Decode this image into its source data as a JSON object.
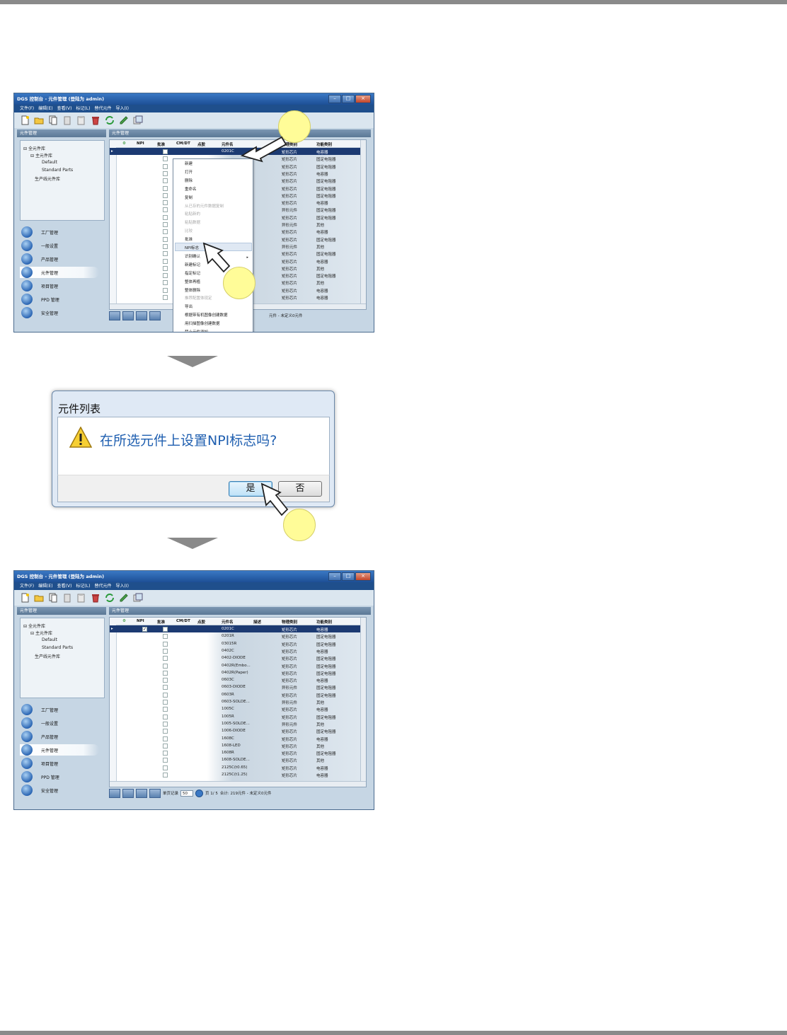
{
  "window": {
    "title": "DGS 控制台 - 元件管理 (登陆为 admin)",
    "menu": [
      "文件(F)",
      "编辑(E)",
      "查看(V)",
      "标记(L)",
      "替代元件",
      "导入(I)"
    ],
    "left_panel_title": "元件管理",
    "right_panel_title": "元件管理",
    "tree": [
      "全元件库",
      "主元件库",
      "Default",
      "Standard Parts",
      "生产线元件库"
    ],
    "nav": [
      "工厂管理",
      "一般设置",
      "产品管理",
      "元件管理",
      "项目管理",
      "PPD 管理",
      "安全管理"
    ],
    "active_nav": "元件管理",
    "columns": [
      "NPI",
      "批准",
      "CM/DT",
      "点胶",
      "元件名",
      "描述",
      "物理类别",
      "功能类别"
    ]
  },
  "screen1": {
    "rows": [
      {
        "name": "0201C",
        "phys": "矩形芯片",
        "func": "电容器"
      },
      {
        "name": "",
        "phys": "矩形芯片",
        "func": "固定电阻器"
      },
      {
        "name": "",
        "phys": "矩形芯片",
        "func": "固定电阻器"
      },
      {
        "name": "",
        "phys": "矩形芯片",
        "func": "电容器"
      },
      {
        "name": "",
        "phys": "矩形芯片",
        "func": "固定电阻器"
      },
      {
        "name": "",
        "phys": "矩形芯片",
        "func": "固定电阻器"
      },
      {
        "name": "",
        "phys": "矩形芯片",
        "func": "固定电阻器"
      },
      {
        "name": "",
        "phys": "矩形芯片",
        "func": "电容器"
      },
      {
        "name": "",
        "phys": "异形元件",
        "func": "固定电阻器"
      },
      {
        "name": "",
        "phys": "矩形芯片",
        "func": "固定电阻器"
      },
      {
        "name": "",
        "phys": "异形元件",
        "func": "其他"
      },
      {
        "name": "",
        "phys": "矩形芯片",
        "func": "电容器"
      },
      {
        "name": "",
        "phys": "矩形芯片",
        "func": "固定电阻器"
      },
      {
        "name": "",
        "phys": "异形元件",
        "func": "其他"
      },
      {
        "name": "",
        "phys": "矩形芯片",
        "func": "固定电阻器"
      },
      {
        "name": "",
        "phys": "矩形芯片",
        "func": "电容器"
      },
      {
        "name": "",
        "phys": "矩形芯片",
        "func": "其他"
      },
      {
        "name": "",
        "phys": "矩形芯片",
        "func": "固定电阻器"
      },
      {
        "name": "",
        "phys": "矩形芯片",
        "func": "其他"
      },
      {
        "name": "",
        "phys": "矩形芯片",
        "func": "电容器"
      },
      {
        "name": "",
        "phys": "矩形芯片",
        "func": "电容器"
      }
    ],
    "status_text": "元件 - 未定义0元件",
    "context_menu": [
      {
        "label": "新建",
        "disabled": false
      },
      {
        "label": "打开",
        "disabled": false
      },
      {
        "label": "删除",
        "disabled": false
      },
      {
        "label": "重命名",
        "disabled": false
      },
      {
        "label": "复制",
        "disabled": false
      },
      {
        "label": "从已存的元件数据复制",
        "disabled": true
      },
      {
        "label": "粘贴新的",
        "disabled": true
      },
      {
        "label": "粘贴数据",
        "disabled": true
      },
      {
        "label": "比较",
        "disabled": true
      },
      {
        "label": "批准",
        "disabled": false
      },
      {
        "label": "NPI标志",
        "disabled": false
      },
      {
        "label": "识别确认",
        "disabled": false
      },
      {
        "label": "新建标记",
        "disabled": false
      },
      {
        "label": "指定标记",
        "disabled": false
      },
      {
        "label": "整体再植",
        "disabled": false
      },
      {
        "label": "整体删除",
        "disabled": false
      },
      {
        "label": "推荐配置体现定",
        "disabled": true
      },
      {
        "label": "导出",
        "disabled": false
      },
      {
        "label": "根据带有机图像创建数据",
        "disabled": false
      },
      {
        "label": "用扫描图像创建数据",
        "disabled": false
      },
      {
        "label": "禁止元件添加",
        "disabled": false
      }
    ]
  },
  "dialog": {
    "title": "元件列表",
    "message": "在所选元件上设置NPI标志吗?",
    "yes": "是",
    "no": "否"
  },
  "screen2": {
    "rows": [
      {
        "name": "0201C",
        "phys": "矩形芯片",
        "func": "电容器",
        "npi": true
      },
      {
        "name": "0201R",
        "phys": "矩形芯片",
        "func": "固定电阻器"
      },
      {
        "name": "03015R",
        "phys": "矩形芯片",
        "func": "固定电阻器"
      },
      {
        "name": "0402C",
        "phys": "矩形芯片",
        "func": "电容器"
      },
      {
        "name": "0402-DIODE",
        "phys": "矩形芯片",
        "func": "固定电阻器"
      },
      {
        "name": "0402R(Embo...",
        "phys": "矩形芯片",
        "func": "固定电阻器"
      },
      {
        "name": "0402R(Paper)",
        "phys": "矩形芯片",
        "func": "固定电阻器"
      },
      {
        "name": "0603C",
        "phys": "矩形芯片",
        "func": "电容器"
      },
      {
        "name": "0603-DIODE",
        "phys": "异形元件",
        "func": "固定电阻器"
      },
      {
        "name": "0603R",
        "phys": "矩形芯片",
        "func": "固定电阻器"
      },
      {
        "name": "0603-SOLDE...",
        "phys": "异形元件",
        "func": "其他"
      },
      {
        "name": "1005C",
        "phys": "矩形芯片",
        "func": "电容器"
      },
      {
        "name": "1005R",
        "phys": "矩形芯片",
        "func": "固定电阻器"
      },
      {
        "name": "1005-SOLDE...",
        "phys": "异形元件",
        "func": "其他"
      },
      {
        "name": "1006-DIODE",
        "phys": "矩形芯片",
        "func": "固定电阻器"
      },
      {
        "name": "1608C",
        "phys": "矩形芯片",
        "func": "电容器"
      },
      {
        "name": "1608-LED",
        "phys": "矩形芯片",
        "func": "其他"
      },
      {
        "name": "1608R",
        "phys": "矩形芯片",
        "func": "固定电阻器"
      },
      {
        "name": "1608-SOLDE...",
        "phys": "矩形芯片",
        "func": "其他"
      },
      {
        "name": "2125C(t0.65)",
        "phys": "矩形芯片",
        "func": "电容器"
      },
      {
        "name": "2125C(t1.25)",
        "phys": "矩形芯片",
        "func": "电容器"
      }
    ],
    "pager": {
      "per_page_label": "单页记录",
      "per_page": "50",
      "page": "页 1/ 5",
      "total": "合计: 219元件 - 未定义0元件"
    }
  },
  "colors": {
    "accent": "#1f4f8c",
    "selection": "#1c3a72",
    "callout": "#fffc98",
    "message": "#1f5fb0"
  }
}
